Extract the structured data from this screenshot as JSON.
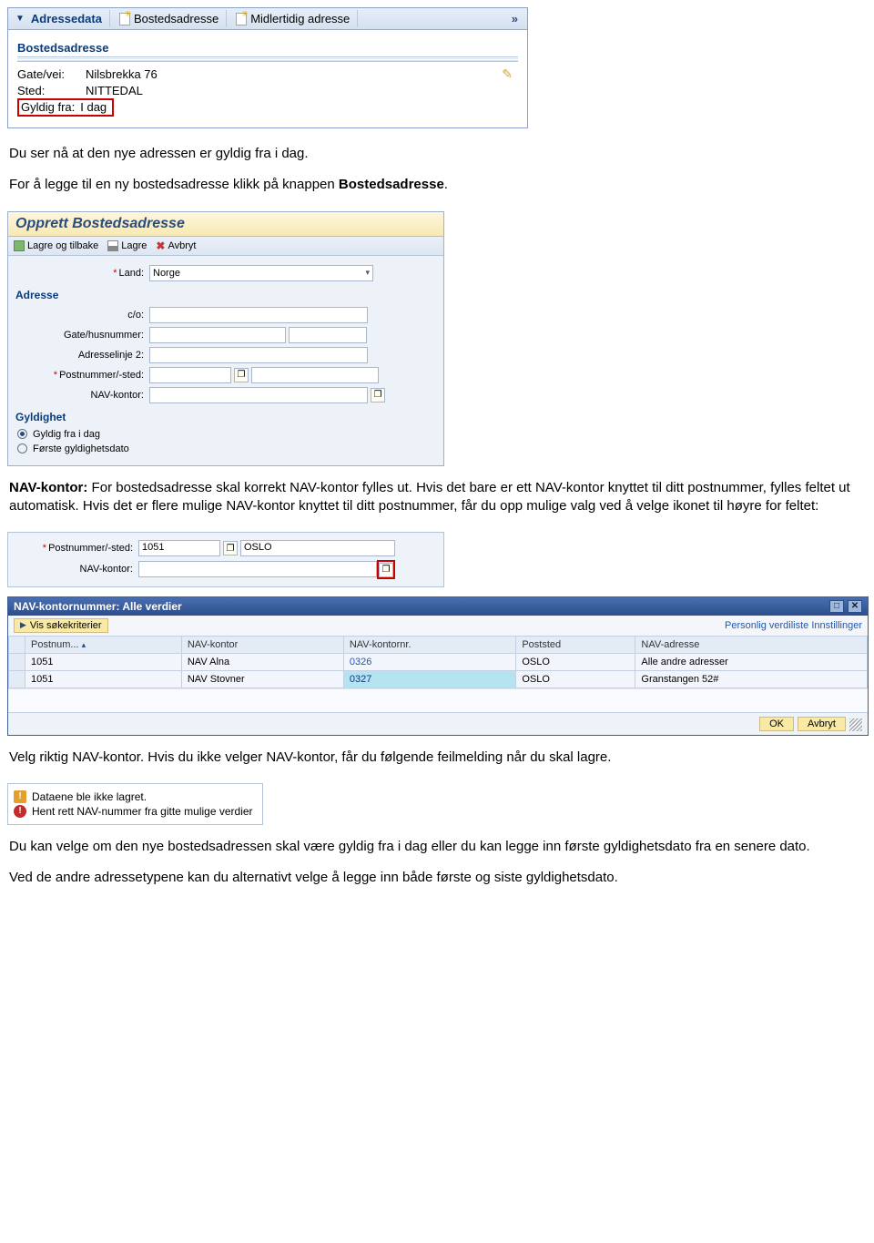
{
  "adressePanel": {
    "tabs": {
      "active": "Adressedata",
      "t1": "Bostedsadresse",
      "t2": "Midlertidig adresse"
    },
    "sectionTitle": "Bostedsadresse",
    "rows": {
      "gateLabel": "Gate/vei:",
      "gateVal": "Nilsbrekka 76",
      "stedLabel": "Sted:",
      "stedVal": "NITTEDAL",
      "gyldigLabel": "Gyldig fra:",
      "gyldigVal": "I dag"
    }
  },
  "para1a": "Du ser nå at den nye adressen er gyldig fra i dag.",
  "para1b_pre": "For å legge til en ny bostedsadresse klikk på knappen ",
  "para1b_bold": "Bostedsadresse",
  "para1b_post": ".",
  "opprett": {
    "title": "Opprett Bostedsadresse",
    "toolbar": {
      "lagreTilbake": "Lagre og tilbake",
      "lagre": "Lagre",
      "avbryt": "Avbryt"
    },
    "fields": {
      "landLabel": "Land:",
      "landVal": "Norge",
      "adresseHeader": "Adresse",
      "coLabel": "c/o:",
      "gateLabel": "Gate/husnummer:",
      "linje2Label": "Adresselinje 2:",
      "postLabel": "Postnummer/-sted:",
      "navLabel": "NAV-kontor:",
      "gyldighetHeader": "Gyldighet",
      "radio1": "Gyldig fra i dag",
      "radio2": "Første gyldighetsdato"
    }
  },
  "para2_bold": "NAV-kontor:",
  "para2": " For bostedsadresse skal korrekt NAV-kontor fylles ut. Hvis det bare er ett NAV-kontor knyttet til ditt postnummer, fylles feltet ut automatisk. Hvis det er flere mulige NAV-kontor knyttet til ditt postnummer, får du opp mulige valg ved å velge ikonet til høyre for feltet:",
  "snippet": {
    "postLabel": "Postnummer/-sted:",
    "postVal": "1051",
    "postSted": "OSLO",
    "navLabel": "NAV-kontor:"
  },
  "dialog": {
    "title": "NAV-kontornummer: Alle verdier",
    "search": "Vis søkekriterier",
    "settings": "Personlig verdiliste Innstillinger",
    "cols": {
      "c1": "Postnum...",
      "c2": "NAV-kontor",
      "c3": "NAV-kontornr.",
      "c4": "Poststed",
      "c5": "NAV-adresse"
    },
    "rows": [
      {
        "post": "1051",
        "kontor": "NAV Alna",
        "nr": "0326",
        "sted": "OSLO",
        "adr": "Alle andre adresser"
      },
      {
        "post": "1051",
        "kontor": "NAV Stovner",
        "nr": "0327",
        "sted": "OSLO",
        "adr": "Granstangen 52#"
      }
    ],
    "ok": "OK",
    "avbryt": "Avbryt"
  },
  "para3": "Velg riktig NAV-kontor. Hvis du ikke velger NAV-kontor, får du følgende feilmelding når du skal lagre.",
  "errors": {
    "e1": "Dataene ble ikke lagret.",
    "e2": "Hent rett NAV-nummer fra gitte mulige verdier"
  },
  "para4": "Du kan velge om den nye bostedsadressen skal være gyldig fra i dag eller du kan legge inn første gyldighetsdato fra en senere dato.",
  "para5": "Ved de andre adressetypene kan du alternativt velge å legge inn både første og siste gyldighetsdato."
}
